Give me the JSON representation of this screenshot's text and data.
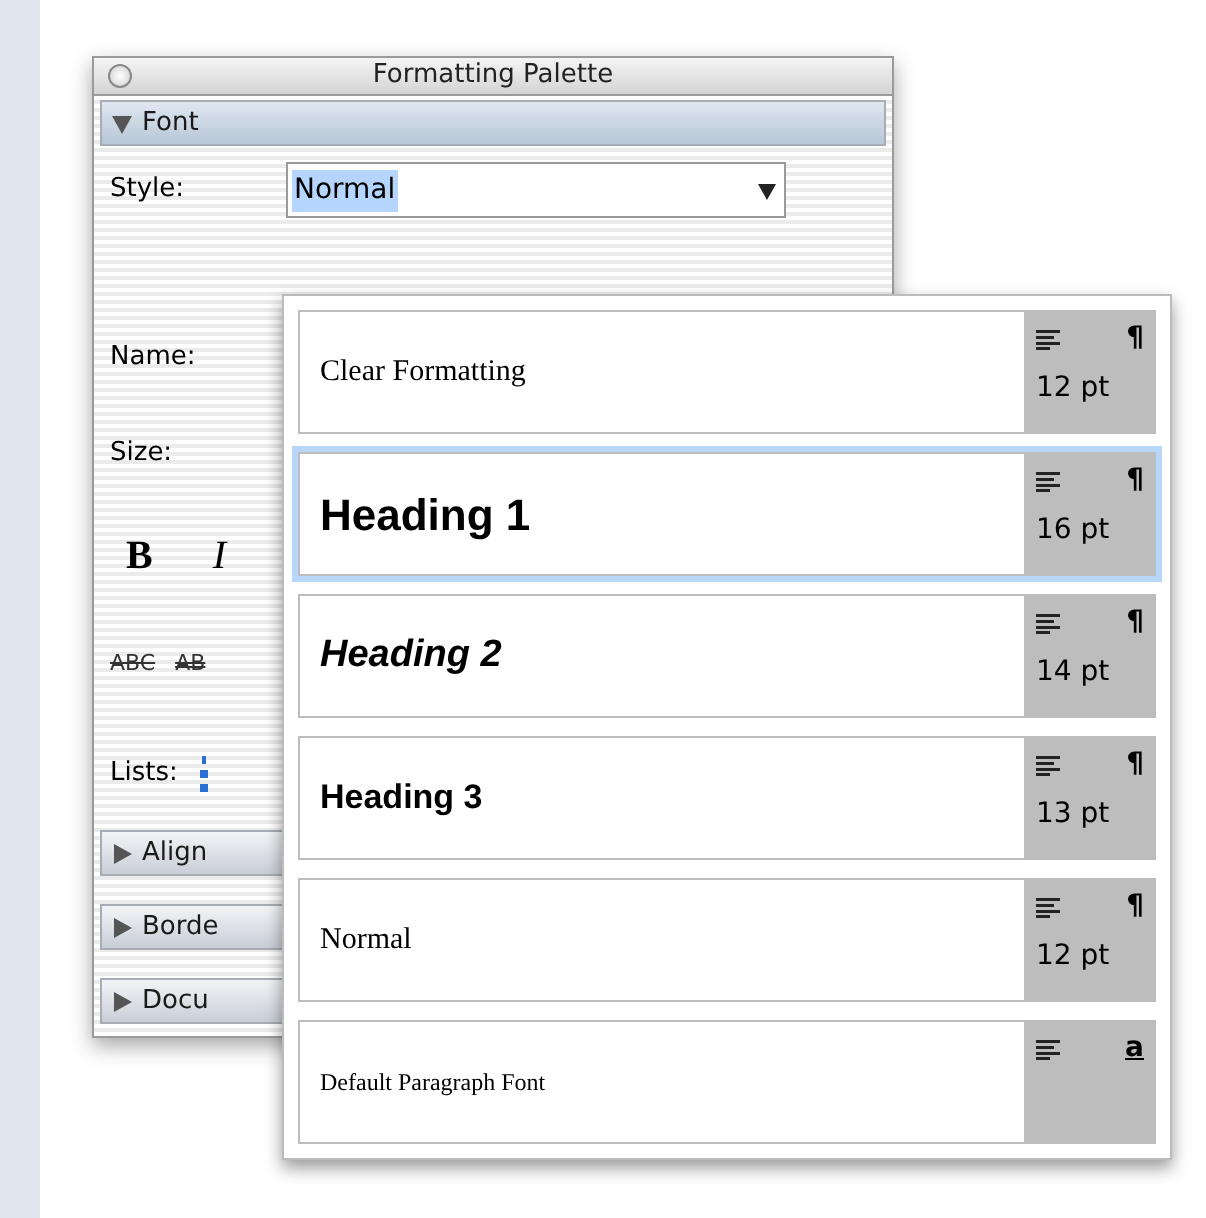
{
  "window": {
    "title": "Formatting Palette"
  },
  "font_section": {
    "label": "Font",
    "expanded": true,
    "style_field": {
      "label": "Style:",
      "value": "Normal"
    },
    "fields": [
      {
        "label": "Name:"
      },
      {
        "label": "Size:"
      }
    ],
    "format_buttons": [
      {
        "label": "B",
        "kind": "bold"
      },
      {
        "label": "I",
        "kind": "italic"
      }
    ],
    "effects": [
      {
        "label": "ABC",
        "kind": "strike"
      },
      {
        "label": "AB",
        "kind": "double-strike"
      }
    ],
    "lists_label": "Lists:"
  },
  "sections": [
    {
      "label": "Align",
      "expanded": false
    },
    {
      "label": "Borde",
      "expanded": false
    },
    {
      "label": "Docu",
      "expanded": false
    }
  ],
  "style_menu": [
    {
      "label": "Clear Formatting",
      "kind": "serif",
      "marker": "¶",
      "size": "12 pt",
      "selected": false
    },
    {
      "label": "Heading 1",
      "kind": "heading1",
      "marker": "¶",
      "size": "16 pt",
      "selected": true
    },
    {
      "label": "Heading 2",
      "kind": "heading2",
      "marker": "¶",
      "size": "14 pt",
      "selected": false
    },
    {
      "label": "Heading 3",
      "kind": "heading3",
      "marker": "¶",
      "size": "13 pt",
      "selected": false
    },
    {
      "label": "Normal",
      "kind": "serif",
      "marker": "¶",
      "size": "12 pt",
      "selected": false
    },
    {
      "label": "Default Paragraph Font",
      "kind": "small-serif",
      "marker": "a",
      "selected": false
    }
  ]
}
